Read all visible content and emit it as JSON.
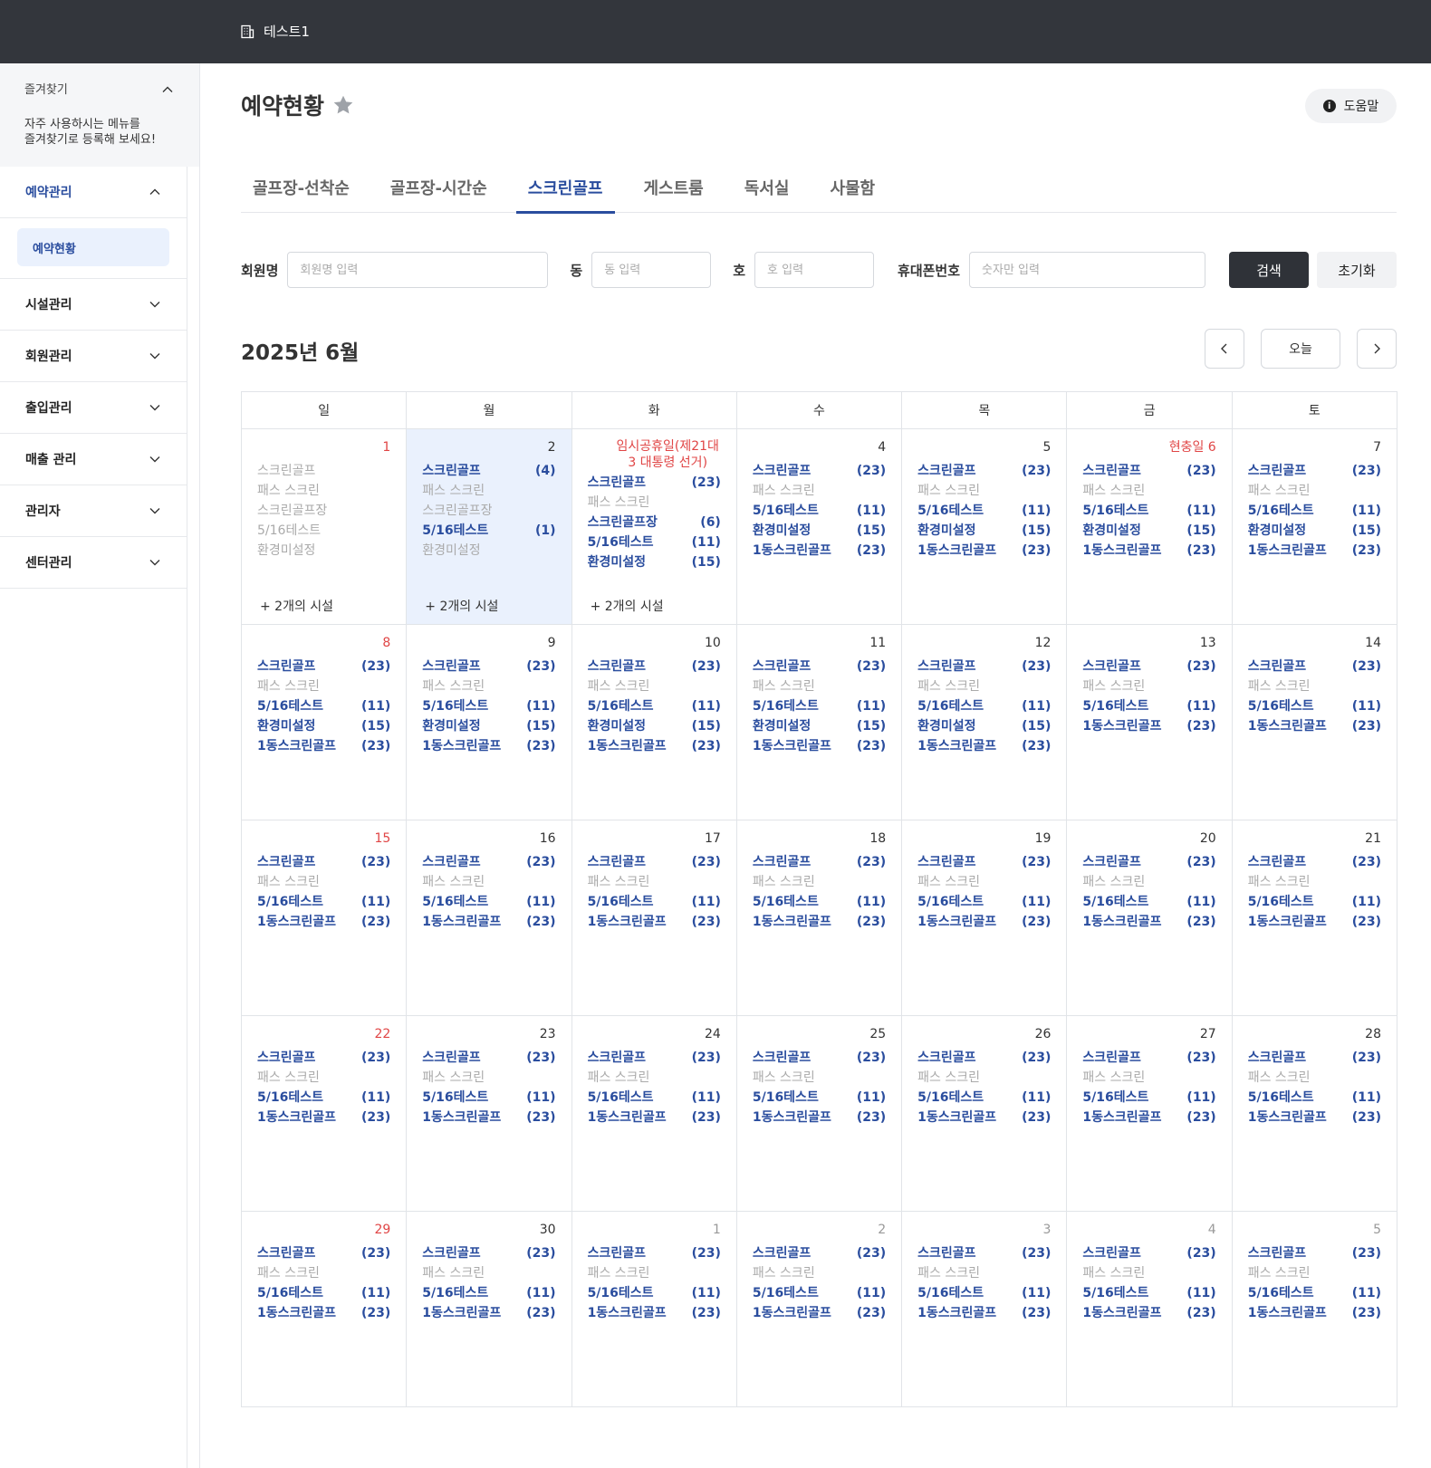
{
  "topbar": {
    "org_name": "테스트1"
  },
  "sidebar": {
    "favorites": {
      "title": "즐겨찾기",
      "desc_line1": "자주 사용하시는 메뉴를",
      "desc_line2": "즐겨찾기로 등록해 보세요!"
    },
    "menu": [
      {
        "label": "예약관리",
        "expanded": true,
        "children": [
          {
            "label": "예약현황",
            "active": true
          }
        ]
      },
      {
        "label": "시설관리"
      },
      {
        "label": "회원관리"
      },
      {
        "label": "출입관리"
      },
      {
        "label": "매출 관리"
      },
      {
        "label": "관리자"
      },
      {
        "label": "센터관리"
      }
    ]
  },
  "page": {
    "title": "예약현황",
    "help_label": "도움말"
  },
  "tabs": [
    {
      "label": "골프장-선착순"
    },
    {
      "label": "골프장-시간순"
    },
    {
      "label": "스크린골프",
      "active": true
    },
    {
      "label": "게스트룸"
    },
    {
      "label": "독서실"
    },
    {
      "label": "사물함"
    }
  ],
  "search": {
    "member_label": "회원명",
    "member_placeholder": "회원명 입력",
    "dong_label": "동",
    "dong_placeholder": "동 입력",
    "ho_label": "호",
    "ho_placeholder": "호 입력",
    "phone_label": "휴대폰번호",
    "phone_placeholder": "숫자만 입력",
    "search_btn": "검색",
    "reset_btn": "초기화"
  },
  "calendar": {
    "title": "2025년 6월",
    "today_btn": "오늘",
    "weekdays": [
      "일",
      "월",
      "화",
      "수",
      "목",
      "금",
      "토"
    ],
    "weeks": [
      [
        {
          "day": "1",
          "color": "red",
          "muted": true,
          "items": [
            [
              "스크린골프",
              ""
            ],
            [
              "패스 스크린",
              ""
            ],
            [
              "스크린골프장",
              ""
            ],
            [
              "5/16테스트",
              ""
            ],
            [
              "환경미설정",
              ""
            ]
          ],
          "more": "+ 2개의 시설"
        },
        {
          "day": "2",
          "selected": true,
          "items": [
            [
              "스크린골프",
              "(4)",
              "b"
            ],
            [
              "패스 스크린",
              "",
              "m"
            ],
            [
              "스크린골프장",
              "",
              "m"
            ],
            [
              "5/16테스트",
              "(1)",
              "b"
            ],
            [
              "환경미설정",
              "",
              "m"
            ]
          ],
          "more": "+ 2개의 시설"
        },
        {
          "day": "3",
          "holiday": "임시공휴일(제21대 3 대통령 선거)",
          "items": [
            [
              "스크린골프",
              "(23)",
              "b"
            ],
            [
              "패스 스크린",
              "",
              "m"
            ],
            [
              "스크린골프장",
              "(6)",
              "b"
            ],
            [
              "5/16테스트",
              "(11)",
              "b"
            ],
            [
              "환경미설정",
              "(15)",
              "b"
            ]
          ],
          "more": "+ 2개의 시설"
        },
        {
          "day": "4",
          "items": [
            [
              "스크린골프",
              "(23)",
              "b"
            ],
            [
              "패스 스크린",
              "",
              "m"
            ],
            [
              "5/16테스트",
              "(11)",
              "b"
            ],
            [
              "환경미설정",
              "(15)",
              "b"
            ],
            [
              "1동스크린골프",
              "(23)",
              "b"
            ]
          ]
        },
        {
          "day": "5",
          "items": [
            [
              "스크린골프",
              "(23)",
              "b"
            ],
            [
              "패스 스크린",
              "",
              "m"
            ],
            [
              "5/16테스트",
              "(11)",
              "b"
            ],
            [
              "환경미설정",
              "(15)",
              "b"
            ],
            [
              "1동스크린골프",
              "(23)",
              "b"
            ]
          ]
        },
        {
          "day": "현충일 6",
          "color": "red",
          "items": [
            [
              "스크린골프",
              "(23)",
              "b"
            ],
            [
              "패스 스크린",
              "",
              "m"
            ],
            [
              "5/16테스트",
              "(11)",
              "b"
            ],
            [
              "환경미설정",
              "(15)",
              "b"
            ],
            [
              "1동스크린골프",
              "(23)",
              "b"
            ]
          ]
        },
        {
          "day": "7",
          "items": [
            [
              "스크린골프",
              "(23)",
              "b"
            ],
            [
              "패스 스크린",
              "",
              "m"
            ],
            [
              "5/16테스트",
              "(11)",
              "b"
            ],
            [
              "환경미설정",
              "(15)",
              "b"
            ],
            [
              "1동스크린골프",
              "(23)",
              "b"
            ]
          ]
        }
      ],
      [
        {
          "day": "8",
          "color": "red",
          "items": [
            [
              "스크린골프",
              "(23)",
              "b"
            ],
            [
              "패스 스크린",
              "",
              "m"
            ],
            [
              "5/16테스트",
              "(11)",
              "b"
            ],
            [
              "환경미설정",
              "(15)",
              "b"
            ],
            [
              "1동스크린골프",
              "(23)",
              "b"
            ]
          ]
        },
        {
          "day": "9",
          "items": [
            [
              "스크린골프",
              "(23)",
              "b"
            ],
            [
              "패스 스크린",
              "",
              "m"
            ],
            [
              "5/16테스트",
              "(11)",
              "b"
            ],
            [
              "환경미설정",
              "(15)",
              "b"
            ],
            [
              "1동스크린골프",
              "(23)",
              "b"
            ]
          ]
        },
        {
          "day": "10",
          "items": [
            [
              "스크린골프",
              "(23)",
              "b"
            ],
            [
              "패스 스크린",
              "",
              "m"
            ],
            [
              "5/16테스트",
              "(11)",
              "b"
            ],
            [
              "환경미설정",
              "(15)",
              "b"
            ],
            [
              "1동스크린골프",
              "(23)",
              "b"
            ]
          ]
        },
        {
          "day": "11",
          "items": [
            [
              "스크린골프",
              "(23)",
              "b"
            ],
            [
              "패스 스크린",
              "",
              "m"
            ],
            [
              "5/16테스트",
              "(11)",
              "b"
            ],
            [
              "환경미설정",
              "(15)",
              "b"
            ],
            [
              "1동스크린골프",
              "(23)",
              "b"
            ]
          ]
        },
        {
          "day": "12",
          "items": [
            [
              "스크린골프",
              "(23)",
              "b"
            ],
            [
              "패스 스크린",
              "",
              "m"
            ],
            [
              "5/16테스트",
              "(11)",
              "b"
            ],
            [
              "환경미설정",
              "(15)",
              "b"
            ],
            [
              "1동스크린골프",
              "(23)",
              "b"
            ]
          ]
        },
        {
          "day": "13",
          "items": [
            [
              "스크린골프",
              "(23)",
              "b"
            ],
            [
              "패스 스크린",
              "",
              "m"
            ],
            [
              "5/16테스트",
              "(11)",
              "b"
            ],
            [
              "1동스크린골프",
              "(23)",
              "b"
            ]
          ]
        },
        {
          "day": "14",
          "items": [
            [
              "스크린골프",
              "(23)",
              "b"
            ],
            [
              "패스 스크린",
              "",
              "m"
            ],
            [
              "5/16테스트",
              "(11)",
              "b"
            ],
            [
              "1동스크린골프",
              "(23)",
              "b"
            ]
          ]
        }
      ],
      [
        {
          "day": "15",
          "color": "red",
          "items": [
            [
              "스크린골프",
              "(23)",
              "b"
            ],
            [
              "패스 스크린",
              "",
              "m"
            ],
            [
              "5/16테스트",
              "(11)",
              "b"
            ],
            [
              "1동스크린골프",
              "(23)",
              "b"
            ]
          ]
        },
        {
          "day": "16",
          "items": [
            [
              "스크린골프",
              "(23)",
              "b"
            ],
            [
              "패스 스크린",
              "",
              "m"
            ],
            [
              "5/16테스트",
              "(11)",
              "b"
            ],
            [
              "1동스크린골프",
              "(23)",
              "b"
            ]
          ]
        },
        {
          "day": "17",
          "items": [
            [
              "스크린골프",
              "(23)",
              "b"
            ],
            [
              "패스 스크린",
              "",
              "m"
            ],
            [
              "5/16테스트",
              "(11)",
              "b"
            ],
            [
              "1동스크린골프",
              "(23)",
              "b"
            ]
          ]
        },
        {
          "day": "18",
          "items": [
            [
              "스크린골프",
              "(23)",
              "b"
            ],
            [
              "패스 스크린",
              "",
              "m"
            ],
            [
              "5/16테스트",
              "(11)",
              "b"
            ],
            [
              "1동스크린골프",
              "(23)",
              "b"
            ]
          ]
        },
        {
          "day": "19",
          "items": [
            [
              "스크린골프",
              "(23)",
              "b"
            ],
            [
              "패스 스크린",
              "",
              "m"
            ],
            [
              "5/16테스트",
              "(11)",
              "b"
            ],
            [
              "1동스크린골프",
              "(23)",
              "b"
            ]
          ]
        },
        {
          "day": "20",
          "items": [
            [
              "스크린골프",
              "(23)",
              "b"
            ],
            [
              "패스 스크린",
              "",
              "m"
            ],
            [
              "5/16테스트",
              "(11)",
              "b"
            ],
            [
              "1동스크린골프",
              "(23)",
              "b"
            ]
          ]
        },
        {
          "day": "21",
          "items": [
            [
              "스크린골프",
              "(23)",
              "b"
            ],
            [
              "패스 스크린",
              "",
              "m"
            ],
            [
              "5/16테스트",
              "(11)",
              "b"
            ],
            [
              "1동스크린골프",
              "(23)",
              "b"
            ]
          ]
        }
      ],
      [
        {
          "day": "22",
          "color": "red",
          "items": [
            [
              "스크린골프",
              "(23)",
              "b"
            ],
            [
              "패스 스크린",
              "",
              "m"
            ],
            [
              "5/16테스트",
              "(11)",
              "b"
            ],
            [
              "1동스크린골프",
              "(23)",
              "b"
            ]
          ]
        },
        {
          "day": "23",
          "items": [
            [
              "스크린골프",
              "(23)",
              "b"
            ],
            [
              "패스 스크린",
              "",
              "m"
            ],
            [
              "5/16테스트",
              "(11)",
              "b"
            ],
            [
              "1동스크린골프",
              "(23)",
              "b"
            ]
          ]
        },
        {
          "day": "24",
          "items": [
            [
              "스크린골프",
              "(23)",
              "b"
            ],
            [
              "패스 스크린",
              "",
              "m"
            ],
            [
              "5/16테스트",
              "(11)",
              "b"
            ],
            [
              "1동스크린골프",
              "(23)",
              "b"
            ]
          ]
        },
        {
          "day": "25",
          "items": [
            [
              "스크린골프",
              "(23)",
              "b"
            ],
            [
              "패스 스크린",
              "",
              "m"
            ],
            [
              "5/16테스트",
              "(11)",
              "b"
            ],
            [
              "1동스크린골프",
              "(23)",
              "b"
            ]
          ]
        },
        {
          "day": "26",
          "items": [
            [
              "스크린골프",
              "(23)",
              "b"
            ],
            [
              "패스 스크린",
              "",
              "m"
            ],
            [
              "5/16테스트",
              "(11)",
              "b"
            ],
            [
              "1동스크린골프",
              "(23)",
              "b"
            ]
          ]
        },
        {
          "day": "27",
          "items": [
            [
              "스크린골프",
              "(23)",
              "b"
            ],
            [
              "패스 스크린",
              "",
              "m"
            ],
            [
              "5/16테스트",
              "(11)",
              "b"
            ],
            [
              "1동스크린골프",
              "(23)",
              "b"
            ]
          ]
        },
        {
          "day": "28",
          "items": [
            [
              "스크린골프",
              "(23)",
              "b"
            ],
            [
              "패스 스크린",
              "",
              "m"
            ],
            [
              "5/16테스트",
              "(11)",
              "b"
            ],
            [
              "1동스크린골프",
              "(23)",
              "b"
            ]
          ]
        }
      ],
      [
        {
          "day": "29",
          "color": "red",
          "items": [
            [
              "스크린골프",
              "(23)",
              "b"
            ],
            [
              "패스 스크린",
              "",
              "m"
            ],
            [
              "5/16테스트",
              "(11)",
              "b"
            ],
            [
              "1동스크린골프",
              "(23)",
              "b"
            ]
          ]
        },
        {
          "day": "30",
          "items": [
            [
              "스크린골프",
              "(23)",
              "b"
            ],
            [
              "패스 스크린",
              "",
              "m"
            ],
            [
              "5/16테스트",
              "(11)",
              "b"
            ],
            [
              "1동스크린골프",
              "(23)",
              "b"
            ]
          ]
        },
        {
          "day": "1",
          "color": "grey",
          "items": [
            [
              "스크린골프",
              "(23)",
              "b"
            ],
            [
              "패스 스크린",
              "",
              "m"
            ],
            [
              "5/16테스트",
              "(11)",
              "b"
            ],
            [
              "1동스크린골프",
              "(23)",
              "b"
            ]
          ]
        },
        {
          "day": "2",
          "color": "grey",
          "items": [
            [
              "스크린골프",
              "(23)",
              "b"
            ],
            [
              "패스 스크린",
              "",
              "m"
            ],
            [
              "5/16테스트",
              "(11)",
              "b"
            ],
            [
              "1동스크린골프",
              "(23)",
              "b"
            ]
          ]
        },
        {
          "day": "3",
          "color": "grey",
          "items": [
            [
              "스크린골프",
              "(23)",
              "b"
            ],
            [
              "패스 스크린",
              "",
              "m"
            ],
            [
              "5/16테스트",
              "(11)",
              "b"
            ],
            [
              "1동스크린골프",
              "(23)",
              "b"
            ]
          ]
        },
        {
          "day": "4",
          "color": "grey",
          "items": [
            [
              "스크린골프",
              "(23)",
              "b"
            ],
            [
              "패스 스크린",
              "",
              "m"
            ],
            [
              "5/16테스트",
              "(11)",
              "b"
            ],
            [
              "1동스크린골프",
              "(23)",
              "b"
            ]
          ]
        },
        {
          "day": "5",
          "color": "grey",
          "items": [
            [
              "스크린골프",
              "(23)",
              "b"
            ],
            [
              "패스 스크린",
              "",
              "m"
            ],
            [
              "5/16테스트",
              "(11)",
              "b"
            ],
            [
              "1동스크린골프",
              "(23)",
              "b"
            ]
          ]
        }
      ]
    ]
  },
  "colors": {
    "accent": "#2a4d9e",
    "topbar": "#33363c",
    "holiday": "#e04545",
    "selected_bg": "#eaf1fd"
  }
}
